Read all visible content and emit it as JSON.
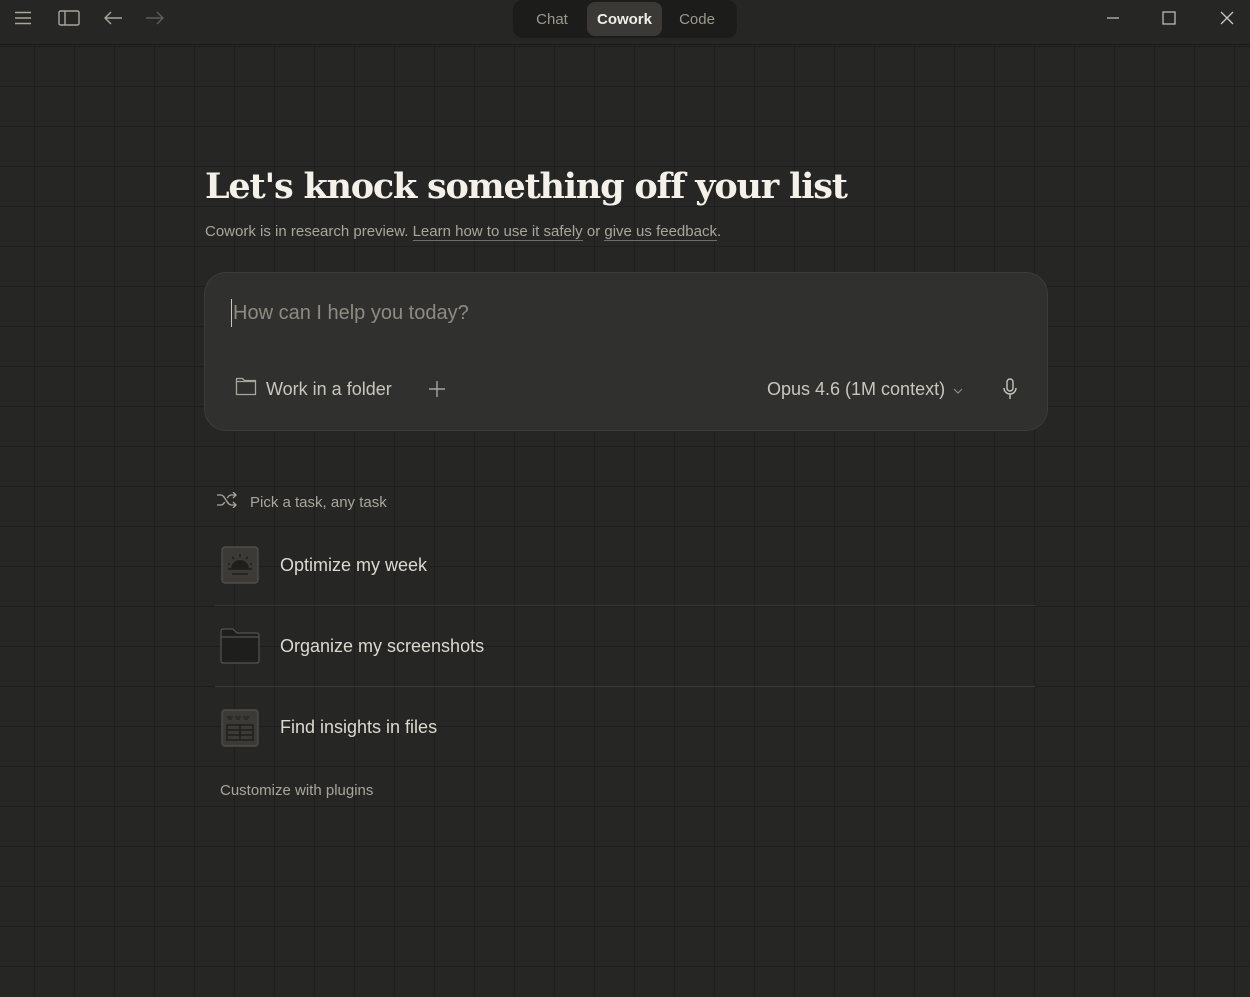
{
  "titlebar": {
    "modes": [
      {
        "label": "Chat",
        "active": false
      },
      {
        "label": "Cowork",
        "active": true
      },
      {
        "label": "Code",
        "active": false
      }
    ]
  },
  "hero": {
    "headline": "Let's knock something off your list",
    "sub_prefix": "Cowork is in research preview. ",
    "learn_link": "Learn how to use it safely",
    "sub_mid": " or ",
    "feedback_link": "give us feedback",
    "sub_suffix": "."
  },
  "composer": {
    "placeholder": "How can I help you today?",
    "value": "",
    "folder_label": "Work in a folder",
    "model_label": "Opus 4.6 (1M context)"
  },
  "tasks": {
    "header": "Pick a task, any task",
    "items": [
      {
        "label": "Optimize my week",
        "icon": "sunrise-calendar-icon"
      },
      {
        "label": "Organize my screenshots",
        "icon": "folder-icon"
      },
      {
        "label": "Find insights in files",
        "icon": "spreadsheet-icon"
      }
    ],
    "footer_link": "Customize with plugins"
  },
  "colors": {
    "background": "#262624",
    "composer_bg": "#30302e",
    "text_primary": "#f3f1ea",
    "text_muted": "#a9a69d"
  }
}
